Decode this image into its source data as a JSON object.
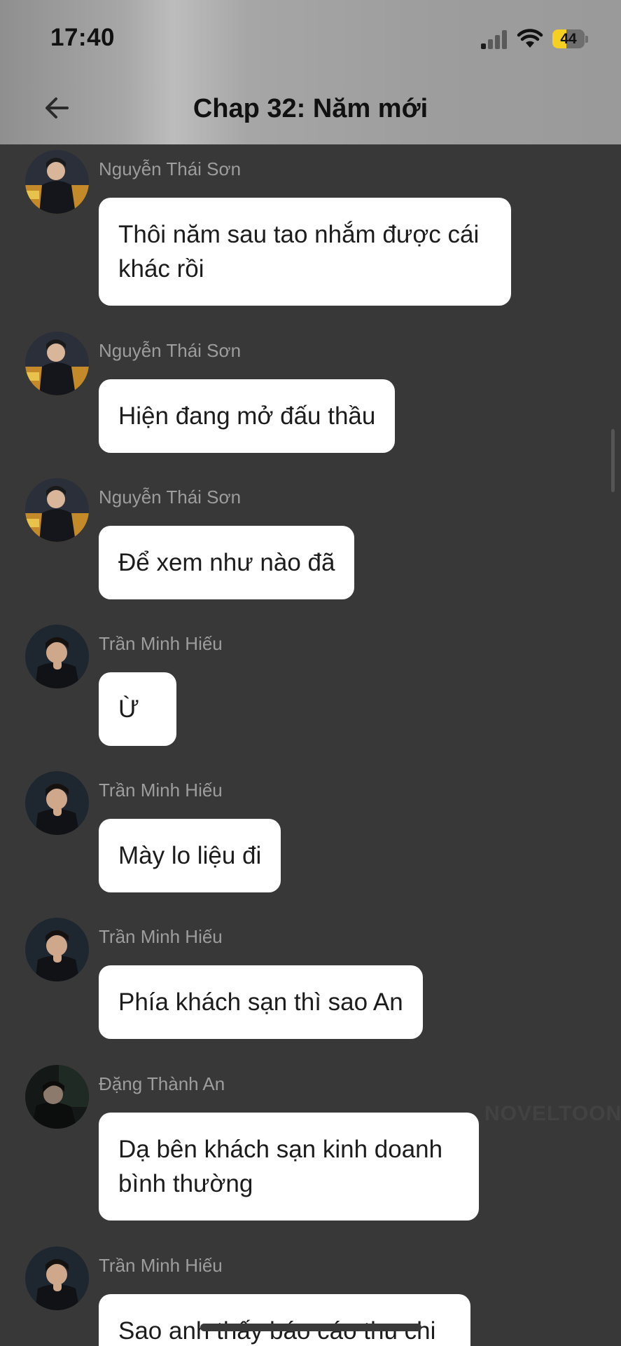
{
  "status_bar": {
    "time": "17:40",
    "battery": "44",
    "battery_fraction": 0.44,
    "signal_bars_active": 1
  },
  "header": {
    "title": "Chap 32: Năm mới",
    "back_icon": "arrow-left-icon"
  },
  "messages": [
    {
      "sender": "Nguyễn Thái Sơn",
      "text": "Thôi năm sau tao nhắm được cái khác rồi"
    },
    {
      "sender": "Nguyễn Thái Sơn",
      "text": "Hiện đang mở đấu thầu"
    },
    {
      "sender": "Nguyễn Thái Sơn",
      "text": "Để xem như nào đã"
    },
    {
      "sender": "Trần Minh Hiếu",
      "text": "Ừ"
    },
    {
      "sender": "Trần Minh Hiếu",
      "text": "Mày lo liệu đi"
    },
    {
      "sender": "Trần Minh Hiếu",
      "text": "Phía khách sạn thì sao An"
    },
    {
      "sender": "Đặng Thành An",
      "text": "Dạ bên khách sạn kinh doanh bình thường"
    },
    {
      "sender": "Trần Minh Hiếu",
      "text": "Sao anh thấy báo cáo thu chi"
    }
  ],
  "watermark": "NOVELTOON",
  "colors": {
    "background": "#383838",
    "bubble": "#ffffff",
    "sender": "#9d9d9d",
    "battery": "#f5d020"
  }
}
